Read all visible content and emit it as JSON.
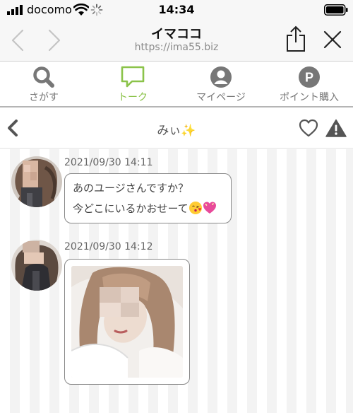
{
  "status_bar": {
    "carrier": "docomo",
    "time": "14:34"
  },
  "browser": {
    "title": "イマココ",
    "url": "https://ima55.biz",
    "icons": [
      "back-chevron-icon",
      "forward-chevron-icon",
      "share-icon",
      "close-icon"
    ]
  },
  "nav": {
    "tabs": [
      {
        "label": "さがす",
        "icon": "search-icon",
        "active": false
      },
      {
        "label": "トーク",
        "icon": "chat-bubble-icon",
        "active": true
      },
      {
        "label": "マイページ",
        "icon": "user-icon",
        "active": false
      },
      {
        "label": "ポイント購入",
        "icon": "points-icon",
        "active": false
      }
    ],
    "active_color": "#8bc34a"
  },
  "chat_header": {
    "name": "みぃ",
    "name_emoji": "✨",
    "icons": [
      "back-chevron-icon",
      "heart-icon",
      "warning-icon"
    ]
  },
  "messages": [
    {
      "timestamp": "2021/09/30 14:11",
      "lines": [
        "あのユージさんですか？",
        "今どこにいるかおせーて"
      ],
      "emojis": [
        "kiss-emoji",
        "heart-emoji"
      ]
    },
    {
      "timestamp": "2021/09/30 14:12",
      "image": "photo-message"
    }
  ]
}
